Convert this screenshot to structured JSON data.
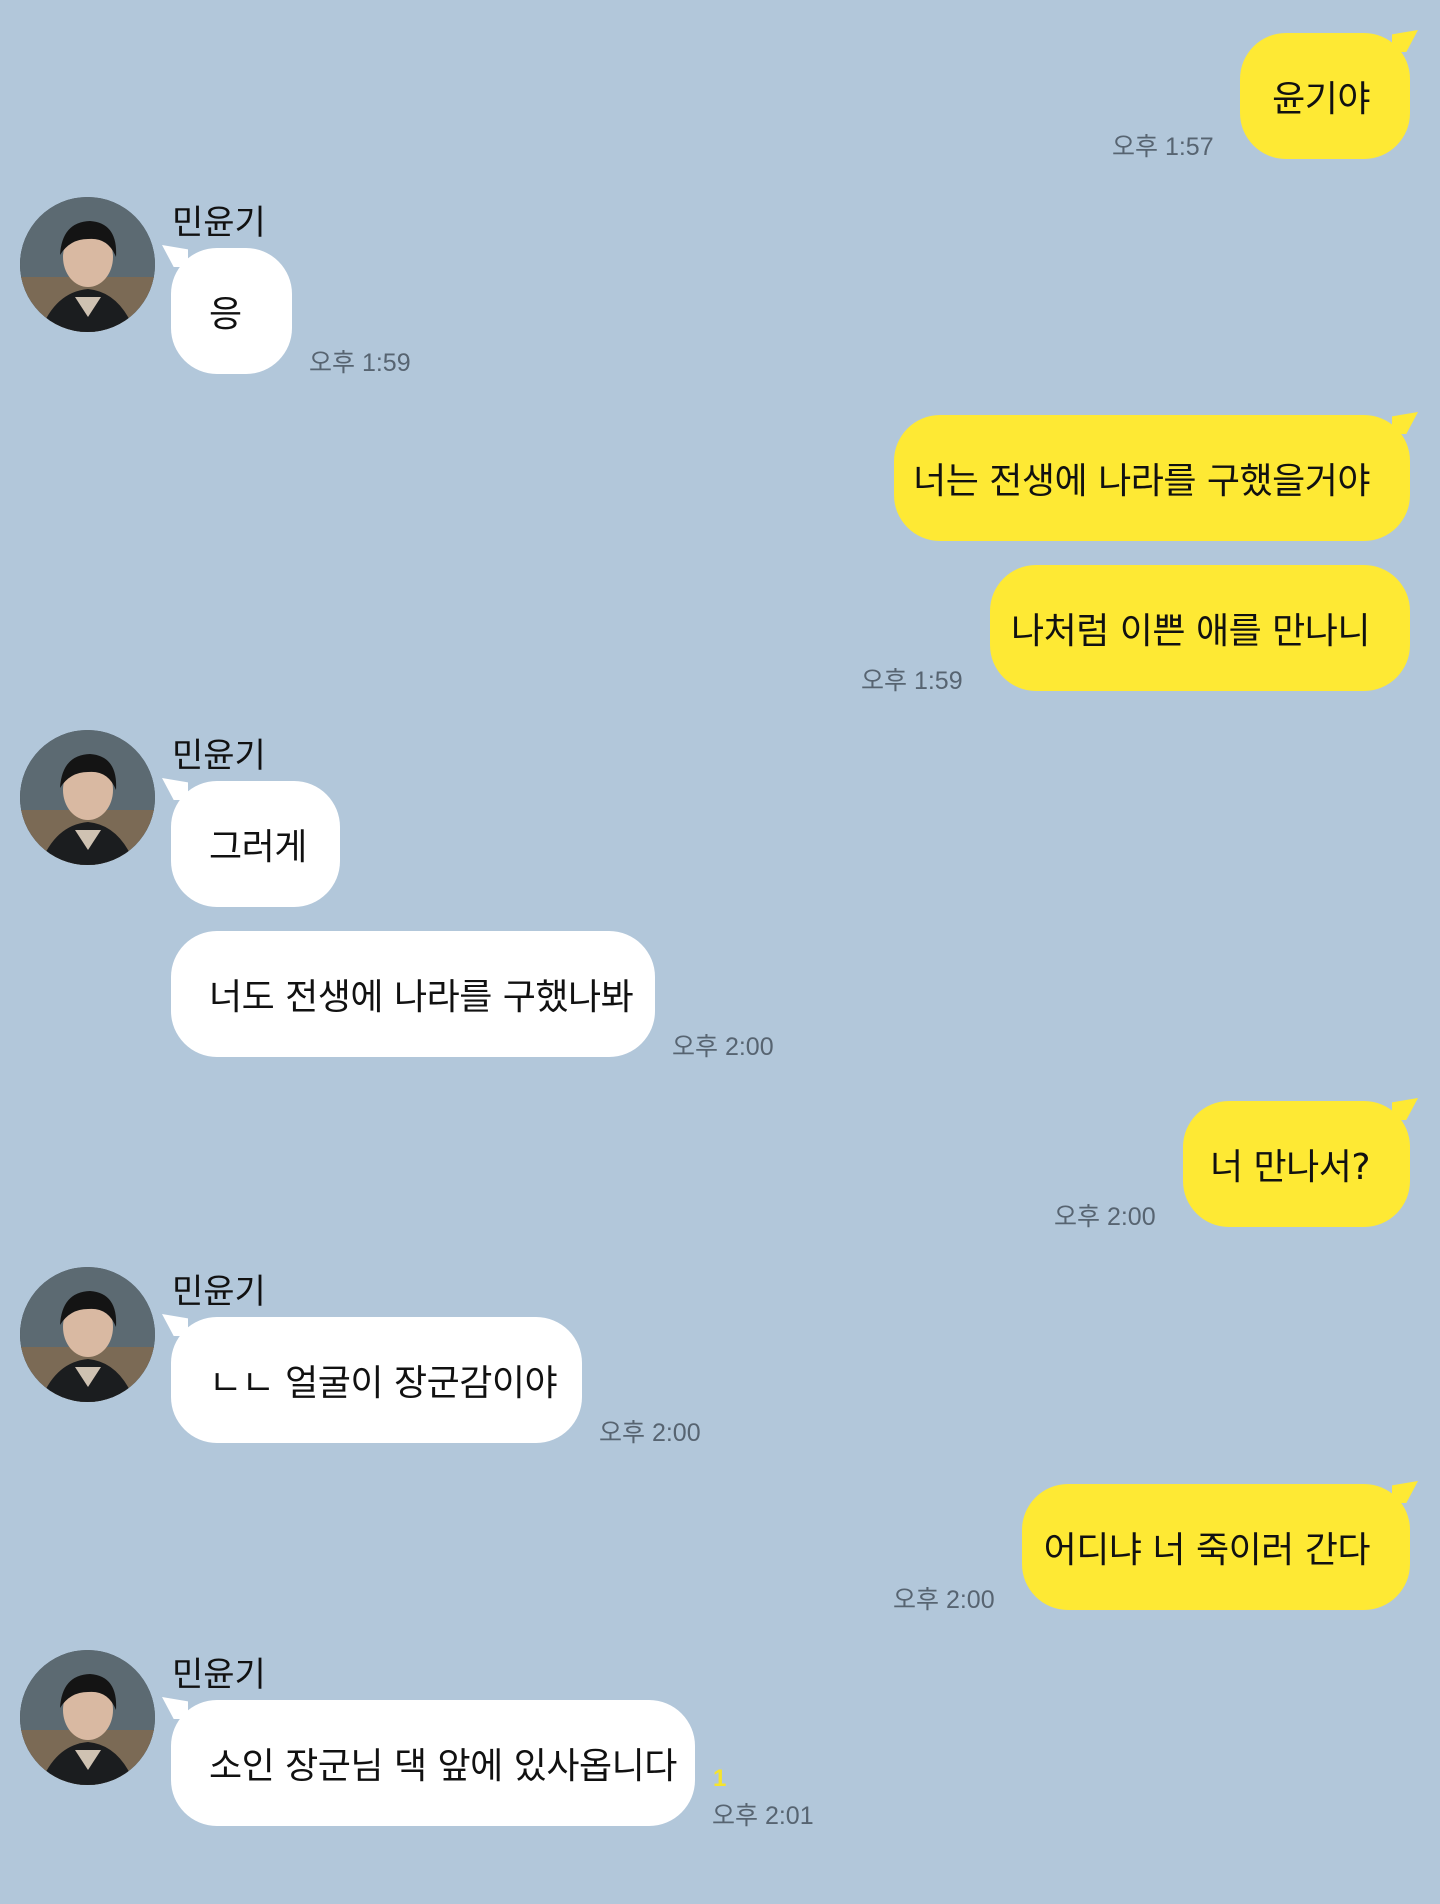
{
  "chat": {
    "friend_name": "민윤기",
    "messages": [
      {
        "text": "윤기야",
        "time": "오후 1:57"
      },
      {
        "text": "응",
        "time": "오후 1:59"
      },
      {
        "text": "너는 전생에 나라를 구했을거야"
      },
      {
        "text": "나처럼 이쁜 애를 만나니",
        "time": "오후 1:59"
      },
      {
        "text": "그러게"
      },
      {
        "text": "너도 전생에 나라를 구했나봐",
        "time": "오후 2:00"
      },
      {
        "text": "너 만나서?",
        "time": "오후 2:00"
      },
      {
        "text": "ㄴㄴ 얼굴이 장군감이야",
        "time": "오후 2:00"
      },
      {
        "text": "어디냐 너 죽이러 간다",
        "time": "오후 2:00"
      },
      {
        "text": "소인 장군님 댁 앞에 있사옵니다",
        "time": "오후 2:01",
        "unread": "1"
      }
    ]
  },
  "colors": {
    "background": "#b2c7da",
    "my_bubble": "#fee934",
    "friend_bubble": "#ffffff",
    "time_text": "#576471",
    "unread_count": "#f6e42c"
  },
  "icons": {
    "avatar": "profile-photo"
  }
}
